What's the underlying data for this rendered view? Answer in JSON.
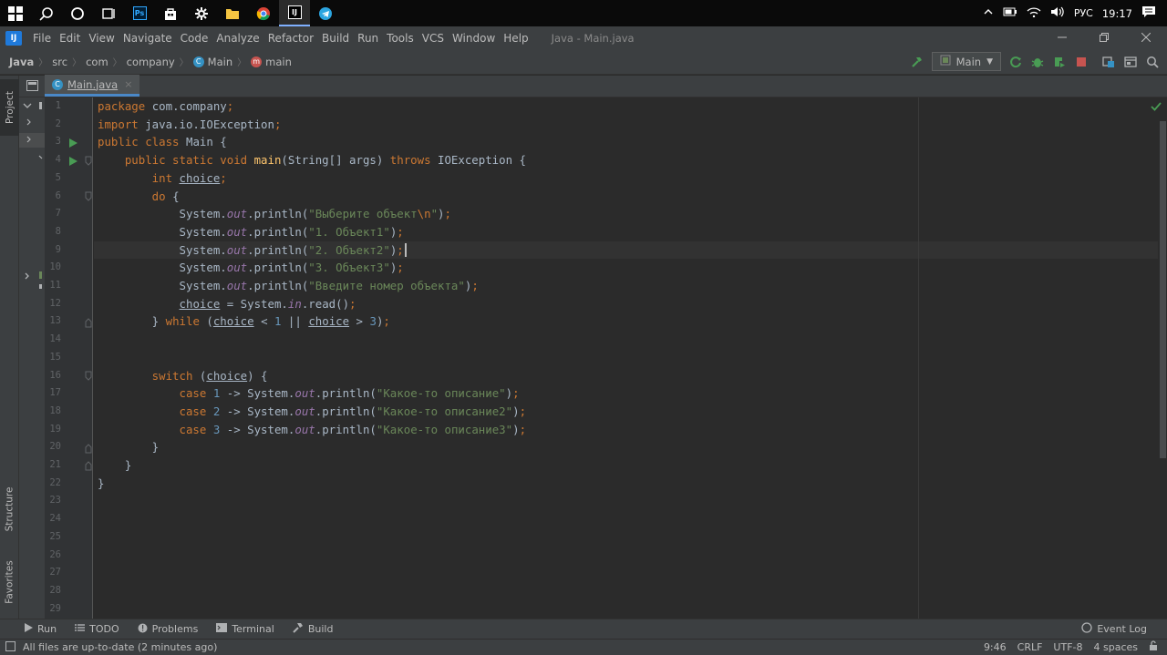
{
  "taskbar": {
    "icons": [
      "windows-start-icon",
      "search-icon",
      "cortana-icon",
      "task-view-icon",
      "photoshop-icon",
      "store-icon",
      "settings-icon",
      "file-explorer-icon",
      "chrome-icon",
      "intellij-icon",
      "telegram-icon"
    ],
    "language": "РУС",
    "time": "19:17"
  },
  "menubar": {
    "items": [
      "File",
      "Edit",
      "View",
      "Navigate",
      "Code",
      "Analyze",
      "Refactor",
      "Build",
      "Run",
      "Tools",
      "VCS",
      "Window",
      "Help"
    ],
    "window_title": "Java - Main.java"
  },
  "breadcrumbs": {
    "items": [
      "Java",
      "src",
      "com",
      "company",
      "Main",
      "main"
    ]
  },
  "toolbar": {
    "run_config": "Main"
  },
  "side_tabs": {
    "project": "Project",
    "structure": "Structure",
    "favorites": "Favorites"
  },
  "editor": {
    "tab_label": "Main.java",
    "line_numbers": [
      "1",
      "2",
      "3",
      "4",
      "5",
      "6",
      "7",
      "8",
      "9",
      "10",
      "11",
      "12",
      "13",
      "14",
      "15",
      "16",
      "17",
      "18",
      "19",
      "20",
      "21",
      "22",
      "23",
      "24",
      "25",
      "26",
      "27",
      "28",
      "29"
    ],
    "lines": [
      [
        {
          "t": "package ",
          "c": "kw"
        },
        {
          "t": "com.company",
          "c": ""
        },
        {
          "t": ";",
          "c": "kw"
        }
      ],
      [
        {
          "t": "import ",
          "c": "kw"
        },
        {
          "t": "java.io.IOException",
          "c": ""
        },
        {
          "t": ";",
          "c": "kw"
        }
      ],
      [
        {
          "t": "public class ",
          "c": "kw"
        },
        {
          "t": "Main {",
          "c": ""
        }
      ],
      [
        {
          "t": "    public static void ",
          "c": "kw"
        },
        {
          "t": "main",
          "c": "fn"
        },
        {
          "t": "(String[] args) ",
          "c": ""
        },
        {
          "t": "throws ",
          "c": "kw"
        },
        {
          "t": "IOException {",
          "c": ""
        }
      ],
      [
        {
          "t": "        int ",
          "c": "kw"
        },
        {
          "t": "choice",
          "c": "ul"
        },
        {
          "t": ";",
          "c": "kw"
        }
      ],
      [
        {
          "t": "        do ",
          "c": "kw"
        },
        {
          "t": "{",
          "c": ""
        }
      ],
      [
        {
          "t": "            System.",
          "c": ""
        },
        {
          "t": "out",
          "c": "it"
        },
        {
          "t": ".println(",
          "c": ""
        },
        {
          "t": "\"Выберите объект",
          "c": "str"
        },
        {
          "t": "\\n",
          "c": "esc"
        },
        {
          "t": "\"",
          "c": "str"
        },
        {
          "t": ")",
          "c": ""
        },
        {
          "t": ";",
          "c": "kw"
        }
      ],
      [
        {
          "t": "            System.",
          "c": ""
        },
        {
          "t": "out",
          "c": "it"
        },
        {
          "t": ".println(",
          "c": ""
        },
        {
          "t": "\"1. Объект1\"",
          "c": "str"
        },
        {
          "t": ")",
          "c": ""
        },
        {
          "t": ";",
          "c": "kw"
        }
      ],
      [
        {
          "t": "            System.",
          "c": ""
        },
        {
          "t": "out",
          "c": "it"
        },
        {
          "t": ".println(",
          "c": ""
        },
        {
          "t": "\"2. Объект2\"",
          "c": "str"
        },
        {
          "t": ")",
          "c": ""
        },
        {
          "t": ";",
          "c": "kw"
        }
      ],
      [
        {
          "t": "            System.",
          "c": ""
        },
        {
          "t": "out",
          "c": "it"
        },
        {
          "t": ".println(",
          "c": ""
        },
        {
          "t": "\"3. Объект3\"",
          "c": "str"
        },
        {
          "t": ")",
          "c": ""
        },
        {
          "t": ";",
          "c": "kw"
        }
      ],
      [
        {
          "t": "            System.",
          "c": ""
        },
        {
          "t": "out",
          "c": "it"
        },
        {
          "t": ".println(",
          "c": ""
        },
        {
          "t": "\"Введите номер объекта\"",
          "c": "str"
        },
        {
          "t": ")",
          "c": ""
        },
        {
          "t": ";",
          "c": "kw"
        }
      ],
      [
        {
          "t": "            ",
          "c": ""
        },
        {
          "t": "choice",
          "c": "ul"
        },
        {
          "t": " = System.",
          "c": ""
        },
        {
          "t": "in",
          "c": "it"
        },
        {
          "t": ".read()",
          "c": ""
        },
        {
          "t": ";",
          "c": "kw"
        }
      ],
      [
        {
          "t": "        } ",
          "c": ""
        },
        {
          "t": "while ",
          "c": "kw"
        },
        {
          "t": "(",
          "c": ""
        },
        {
          "t": "choice",
          "c": "ul"
        },
        {
          "t": " < ",
          "c": ""
        },
        {
          "t": "1",
          "c": "num"
        },
        {
          "t": " || ",
          "c": ""
        },
        {
          "t": "choice",
          "c": "ul"
        },
        {
          "t": " > ",
          "c": ""
        },
        {
          "t": "3",
          "c": "num"
        },
        {
          "t": ")",
          "c": ""
        },
        {
          "t": ";",
          "c": "kw"
        }
      ],
      [],
      [],
      [
        {
          "t": "        switch ",
          "c": "kw"
        },
        {
          "t": "(",
          "c": ""
        },
        {
          "t": "choice",
          "c": "ul"
        },
        {
          "t": ") {",
          "c": ""
        }
      ],
      [
        {
          "t": "            case ",
          "c": "kw"
        },
        {
          "t": "1",
          "c": "num"
        },
        {
          "t": " -> System.",
          "c": ""
        },
        {
          "t": "out",
          "c": "it"
        },
        {
          "t": ".println(",
          "c": ""
        },
        {
          "t": "\"Какое-то описание\"",
          "c": "str"
        },
        {
          "t": ")",
          "c": ""
        },
        {
          "t": ";",
          "c": "kw"
        }
      ],
      [
        {
          "t": "            case ",
          "c": "kw"
        },
        {
          "t": "2",
          "c": "num"
        },
        {
          "t": " -> System.",
          "c": ""
        },
        {
          "t": "out",
          "c": "it"
        },
        {
          "t": ".println(",
          "c": ""
        },
        {
          "t": "\"Какое-то описание2\"",
          "c": "str"
        },
        {
          "t": ")",
          "c": ""
        },
        {
          "t": ";",
          "c": "kw"
        }
      ],
      [
        {
          "t": "            case ",
          "c": "kw"
        },
        {
          "t": "3",
          "c": "num"
        },
        {
          "t": " -> System.",
          "c": ""
        },
        {
          "t": "out",
          "c": "it"
        },
        {
          "t": ".println(",
          "c": ""
        },
        {
          "t": "\"Какое-то описание3\"",
          "c": "str"
        },
        {
          "t": ")",
          "c": ""
        },
        {
          "t": ";",
          "c": "kw"
        }
      ],
      [
        {
          "t": "        }",
          "c": ""
        }
      ],
      [
        {
          "t": "    }",
          "c": ""
        }
      ],
      [
        {
          "t": "}",
          "c": ""
        }
      ],
      [],
      [],
      [],
      [],
      [],
      [],
      []
    ]
  },
  "bottom_tools": {
    "run": "Run",
    "todo": "TODO",
    "problems": "Problems",
    "terminal": "Terminal",
    "build": "Build",
    "event_log": "Event Log"
  },
  "status": {
    "message": "All files are up-to-date (2 minutes ago)",
    "position": "9:46",
    "line_sep": "CRLF",
    "encoding": "UTF-8",
    "indent": "4 spaces"
  },
  "colors": {
    "accent": "#4a88c7",
    "run_green": "#499c54",
    "stop_red": "#c75450"
  }
}
